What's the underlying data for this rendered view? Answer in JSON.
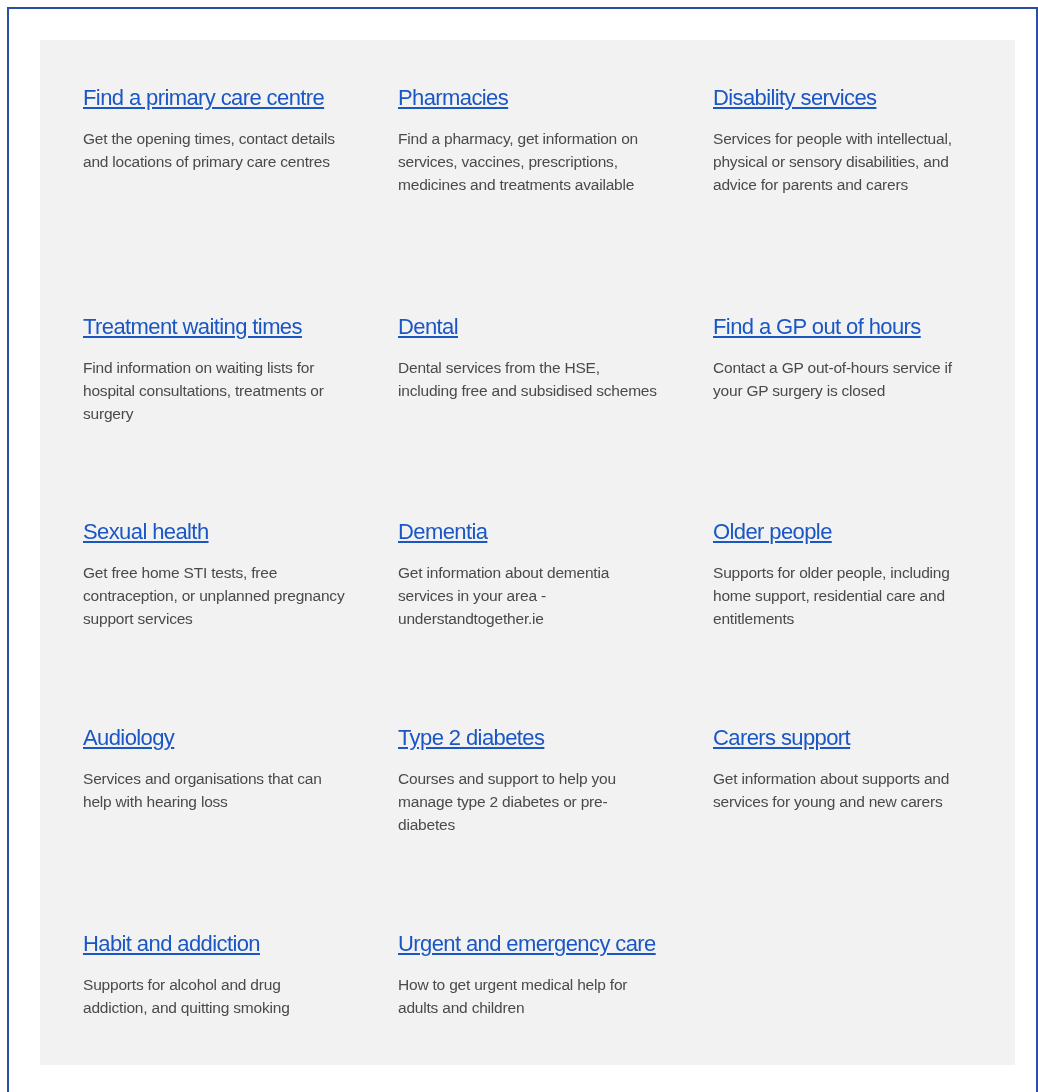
{
  "services": [
    {
      "title": "Find a primary care centre",
      "description": "Get the opening times, contact details and locations of primary care centres"
    },
    {
      "title": "Pharmacies",
      "description": "Find a pharmacy, get information on services, vaccines, prescriptions, medicines and treatments available"
    },
    {
      "title": "Disability services",
      "description": "Services for people with intellectual, physical or sensory disabilities, and advice for parents and carers"
    },
    {
      "title": "Treatment waiting times",
      "description": "Find information on waiting lists for hospital consultations, treatments or surgery"
    },
    {
      "title": "Dental",
      "description": "Dental services from the HSE, including free and subsidised schemes"
    },
    {
      "title": "Find a GP out of hours",
      "description": "Contact a GP out-of-hours service if your GP surgery is closed"
    },
    {
      "title": "Sexual health",
      "description": "Get free home STI tests, free contraception, or unplanned pregnancy support services"
    },
    {
      "title": "Dementia",
      "description": "Get information about dementia services in your area - understandtogether.ie"
    },
    {
      "title": "Older people",
      "description": "Supports for older people, including home support, residential care and entitlements"
    },
    {
      "title": "Audiology",
      "description": "Services and organisations that can help with hearing loss"
    },
    {
      "title": "Type 2 diabetes",
      "description": "Courses and support to help you manage type 2 diabetes or pre-diabetes"
    },
    {
      "title": "Carers support",
      "description": "Get information about supports and services for young and new carers"
    },
    {
      "title": "Habit and addiction",
      "description": "Supports for alcohol and drug addiction, and quitting smoking"
    },
    {
      "title": "Urgent and emergency care",
      "description": "How to get urgent medical help for adults and children"
    }
  ]
}
